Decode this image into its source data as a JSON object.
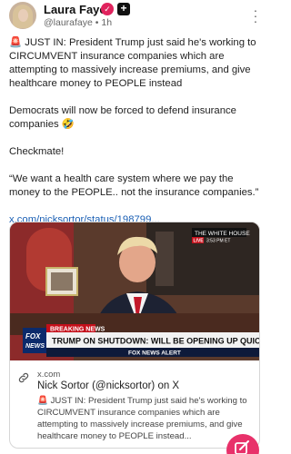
{
  "author": {
    "name": "Laura Faye",
    "handle": "@laurafaye",
    "time": "• 1h"
  },
  "post": {
    "paragraphs": [
      "🚨 JUST IN: President Trump just said he's working to CIRCUMVENT insurance companies which are attempting to massively increase premiums, and give healthcare money to PEOPLE instead",
      "Democrats will now be forced to defend insurance companies 🤣",
      "Checkmate!",
      "“We want a health care system where we pay the money to the PEOPLE.. not the insurance companies.”"
    ],
    "link_text": "x.com/nicksortor/status/198799..."
  },
  "card": {
    "domain": "x.com",
    "title": "Nick Sortor (@nicksortor) on X",
    "description": "🚨 JUST IN: President Trump just said he's working to CIRCUMVENT insurance companies which are attempting to massively increase premiums, and give healthcare money to PEOPLE instead...",
    "media": {
      "breaking_label": "BREAKING NEWS",
      "headline": "TRUMP ON SHUTDOWN: WILL BE OPENING UP QUICKLY",
      "network_top": "FOX",
      "network_bottom": "NEWS",
      "alert_text": "FOX NEWS ALERT",
      "source_tag": "THE WHITE HOUSE",
      "live_label": "LIVE",
      "clock": "3:53 PM ET"
    }
  },
  "colors": {
    "accent": "#e8316a",
    "link": "#1a5fb4"
  },
  "icons": {
    "verified": "verified-badge-icon",
    "follow": "plus-icon",
    "more": "more-vertical-icon",
    "link": "link-icon",
    "compose": "compose-icon"
  }
}
